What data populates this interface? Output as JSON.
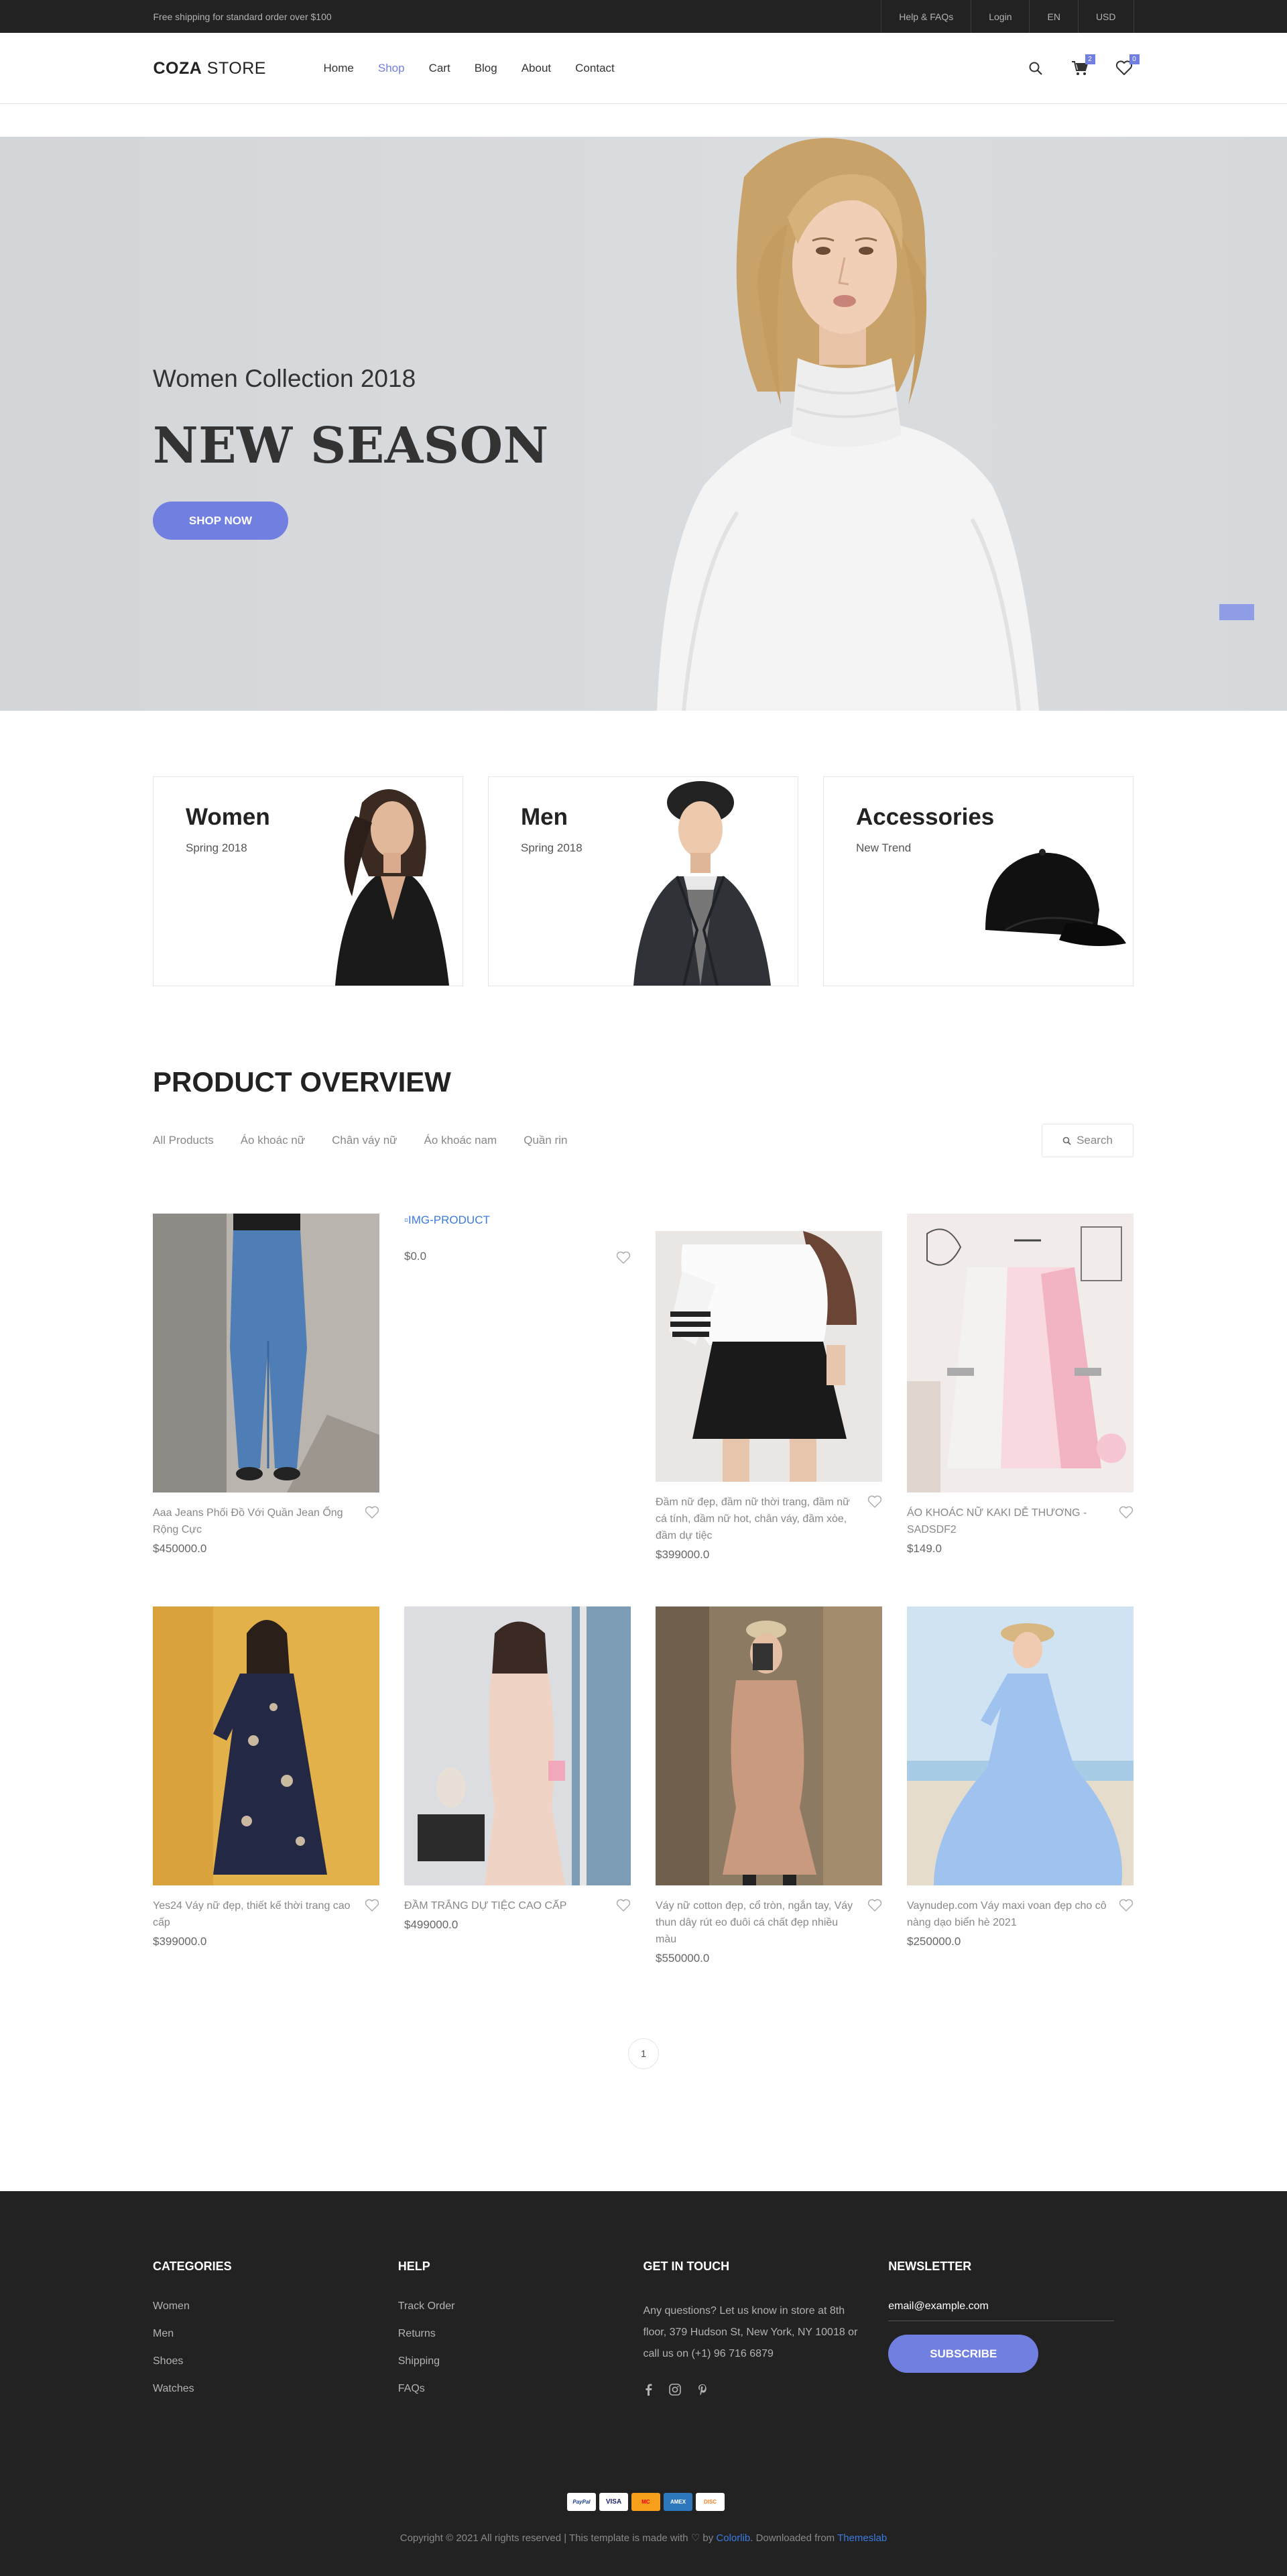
{
  "topbar": {
    "shipping_text": "Free shipping for standard order over $100",
    "links": [
      "Help & FAQs",
      "Login",
      "EN",
      "USD"
    ]
  },
  "header": {
    "logo_bold": "COZA",
    "logo_rest": " STORE",
    "nav": [
      "Home",
      "Shop",
      "Cart",
      "Blog",
      "About",
      "Contact"
    ],
    "active_nav": "Shop",
    "cart_count": "2",
    "wishlist_count": "0"
  },
  "hero": {
    "subtitle": "Women Collection 2018",
    "title": "NEW SEASON",
    "button": "SHOP NOW"
  },
  "banners": [
    {
      "title": "Women",
      "subtitle": "Spring 2018"
    },
    {
      "title": "Men",
      "subtitle": "Spring 2018"
    },
    {
      "title": "Accessories",
      "subtitle": "New Trend"
    }
  ],
  "overview": {
    "title": "PRODUCT OVERVIEW",
    "filters": [
      "All Products",
      "Áo khoác nữ",
      "Chân váy nữ",
      "Áo khoác nam",
      "Quần rin"
    ],
    "search_label": "Search"
  },
  "products": [
    {
      "name": "Aaa Jeans Phối Đồ Với Quần Jean Ống Rộng Cực",
      "price": "$450000.0"
    },
    {
      "name": "",
      "price": "$0.0",
      "img_alt": "IMG-PRODUCT"
    },
    {
      "name": "Đầm nữ đẹp, đầm nữ thời trang, đầm nữ cá tính, đầm nữ hot, chân váy, đầm xòe, đầm dự tiệc",
      "price": "$399000.0"
    },
    {
      "name": "ÁO KHOÁC NỮ KAKI DỄ THƯƠNG - SADSDF2",
      "price": "$149.0"
    },
    {
      "name": "Yes24 Váy nữ đẹp, thiết kế thời trang cao cấp",
      "price": "$399000.0"
    },
    {
      "name": "ĐẦM TRẮNG DỰ TIỆC CAO CẤP",
      "price": "$499000.0"
    },
    {
      "name": "Váy nữ cotton đẹp, cổ tròn, ngắn tay, Váy thun dây rút eo đuôi cá chất đẹp nhiều màu",
      "price": "$550000.0"
    },
    {
      "name": "Vaynudep.com Váy maxi voan đẹp cho cô nàng dạo biển hè 2021",
      "price": "$250000.0"
    }
  ],
  "pagination": {
    "current": "1"
  },
  "footer": {
    "categories": {
      "title": "CATEGORIES",
      "items": [
        "Women",
        "Men",
        "Shoes",
        "Watches"
      ]
    },
    "help": {
      "title": "HELP",
      "items": [
        "Track Order",
        "Returns",
        "Shipping",
        "FAQs"
      ]
    },
    "contact": {
      "title": "GET IN TOUCH",
      "text": "Any questions? Let us know in store at 8th floor, 379 Hudson St, New York, NY 10018 or call us on (+1) 96 716 6879"
    },
    "newsletter": {
      "title": "NEWSLETTER",
      "placeholder": "email@example.com",
      "button": "SUBSCRIBE"
    },
    "payments": [
      "PayPal",
      "VISA",
      "MC",
      "AMEX",
      "DISC"
    ],
    "copyright_prefix": "Copyright © 2021 All rights reserved | This template is made with ♡ by ",
    "colorlib": "Colorlib",
    "copyright_middle": ". Downloaded from ",
    "themeslab": "Themeslab"
  },
  "colors": {
    "accent": "#717fe0",
    "dark": "#222222"
  }
}
